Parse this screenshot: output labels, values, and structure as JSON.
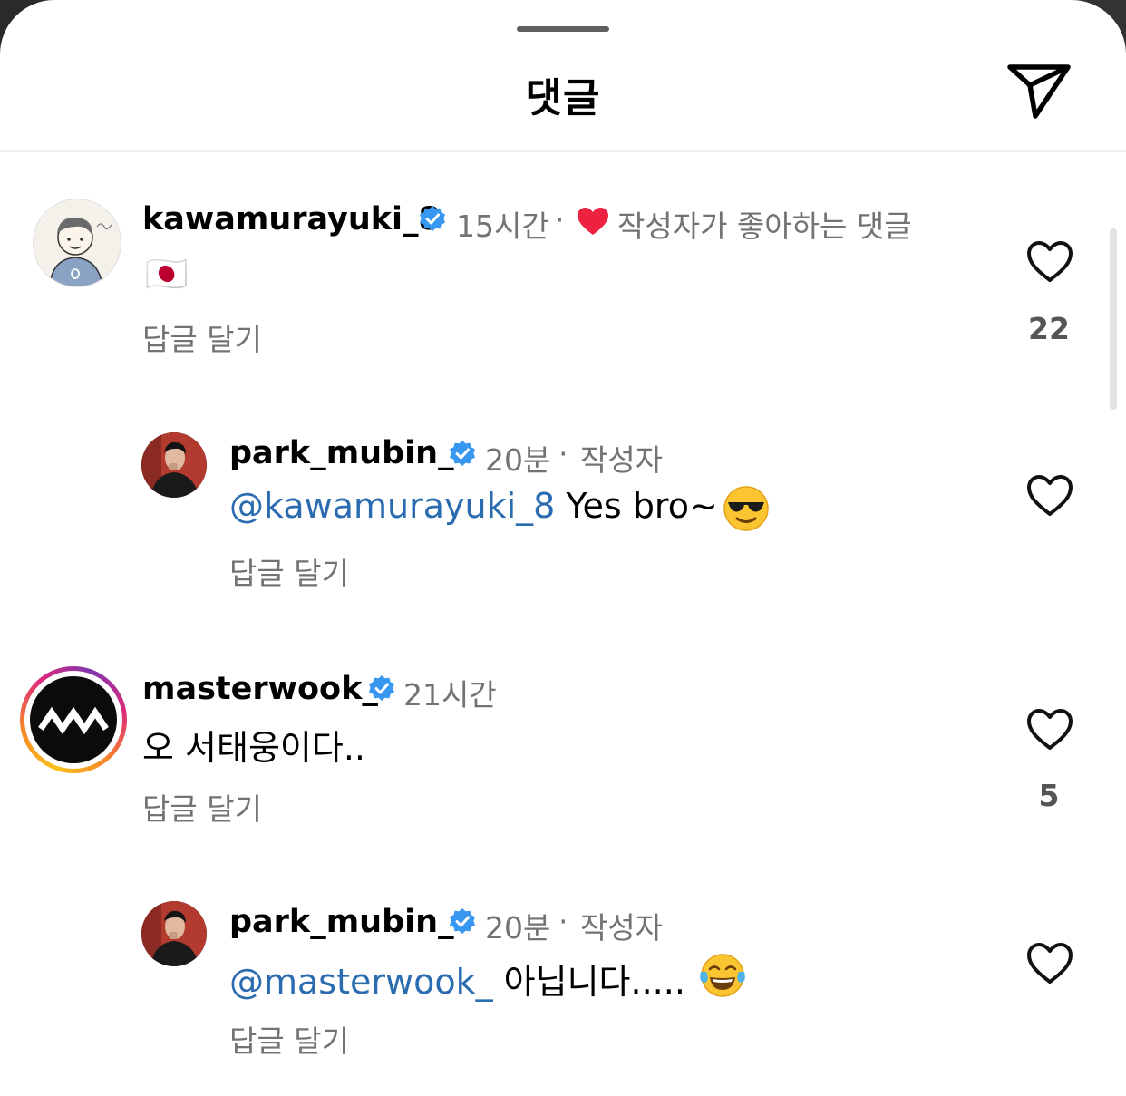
{
  "header": {
    "title": "댓글",
    "share_icon": "paper-plane-icon"
  },
  "comments": [
    {
      "username": "kawamurayuki_8",
      "time": "15시간",
      "separator": "·",
      "liked_by_author": "작성자가 좋아하는 댓글",
      "text": "🇯🇵",
      "reply_label": "답글 달기",
      "likes": "22"
    },
    {
      "username": "park_mubin_",
      "time": "20분",
      "separator": "·",
      "author_badge": "작성자",
      "mention": "@kawamurayuki_8",
      "text": " Yes bro~",
      "reply_label": "답글 달기"
    },
    {
      "username": "masterwook_",
      "time": "21시간",
      "text": "오 서태웅이다..",
      "reply_label": "답글 달기",
      "likes": "5"
    },
    {
      "username": "park_mubin_",
      "time": "20분",
      "separator": "·",
      "author_badge": "작성자",
      "mention": "@masterwook_",
      "text": " 아닙니다.....",
      "reply_label": "답글 달기"
    }
  ],
  "colors": {
    "mention": "#2b6cb0",
    "verified": "#3897f0",
    "heart_red": "#ed2140",
    "secondary_text": "#737373"
  }
}
